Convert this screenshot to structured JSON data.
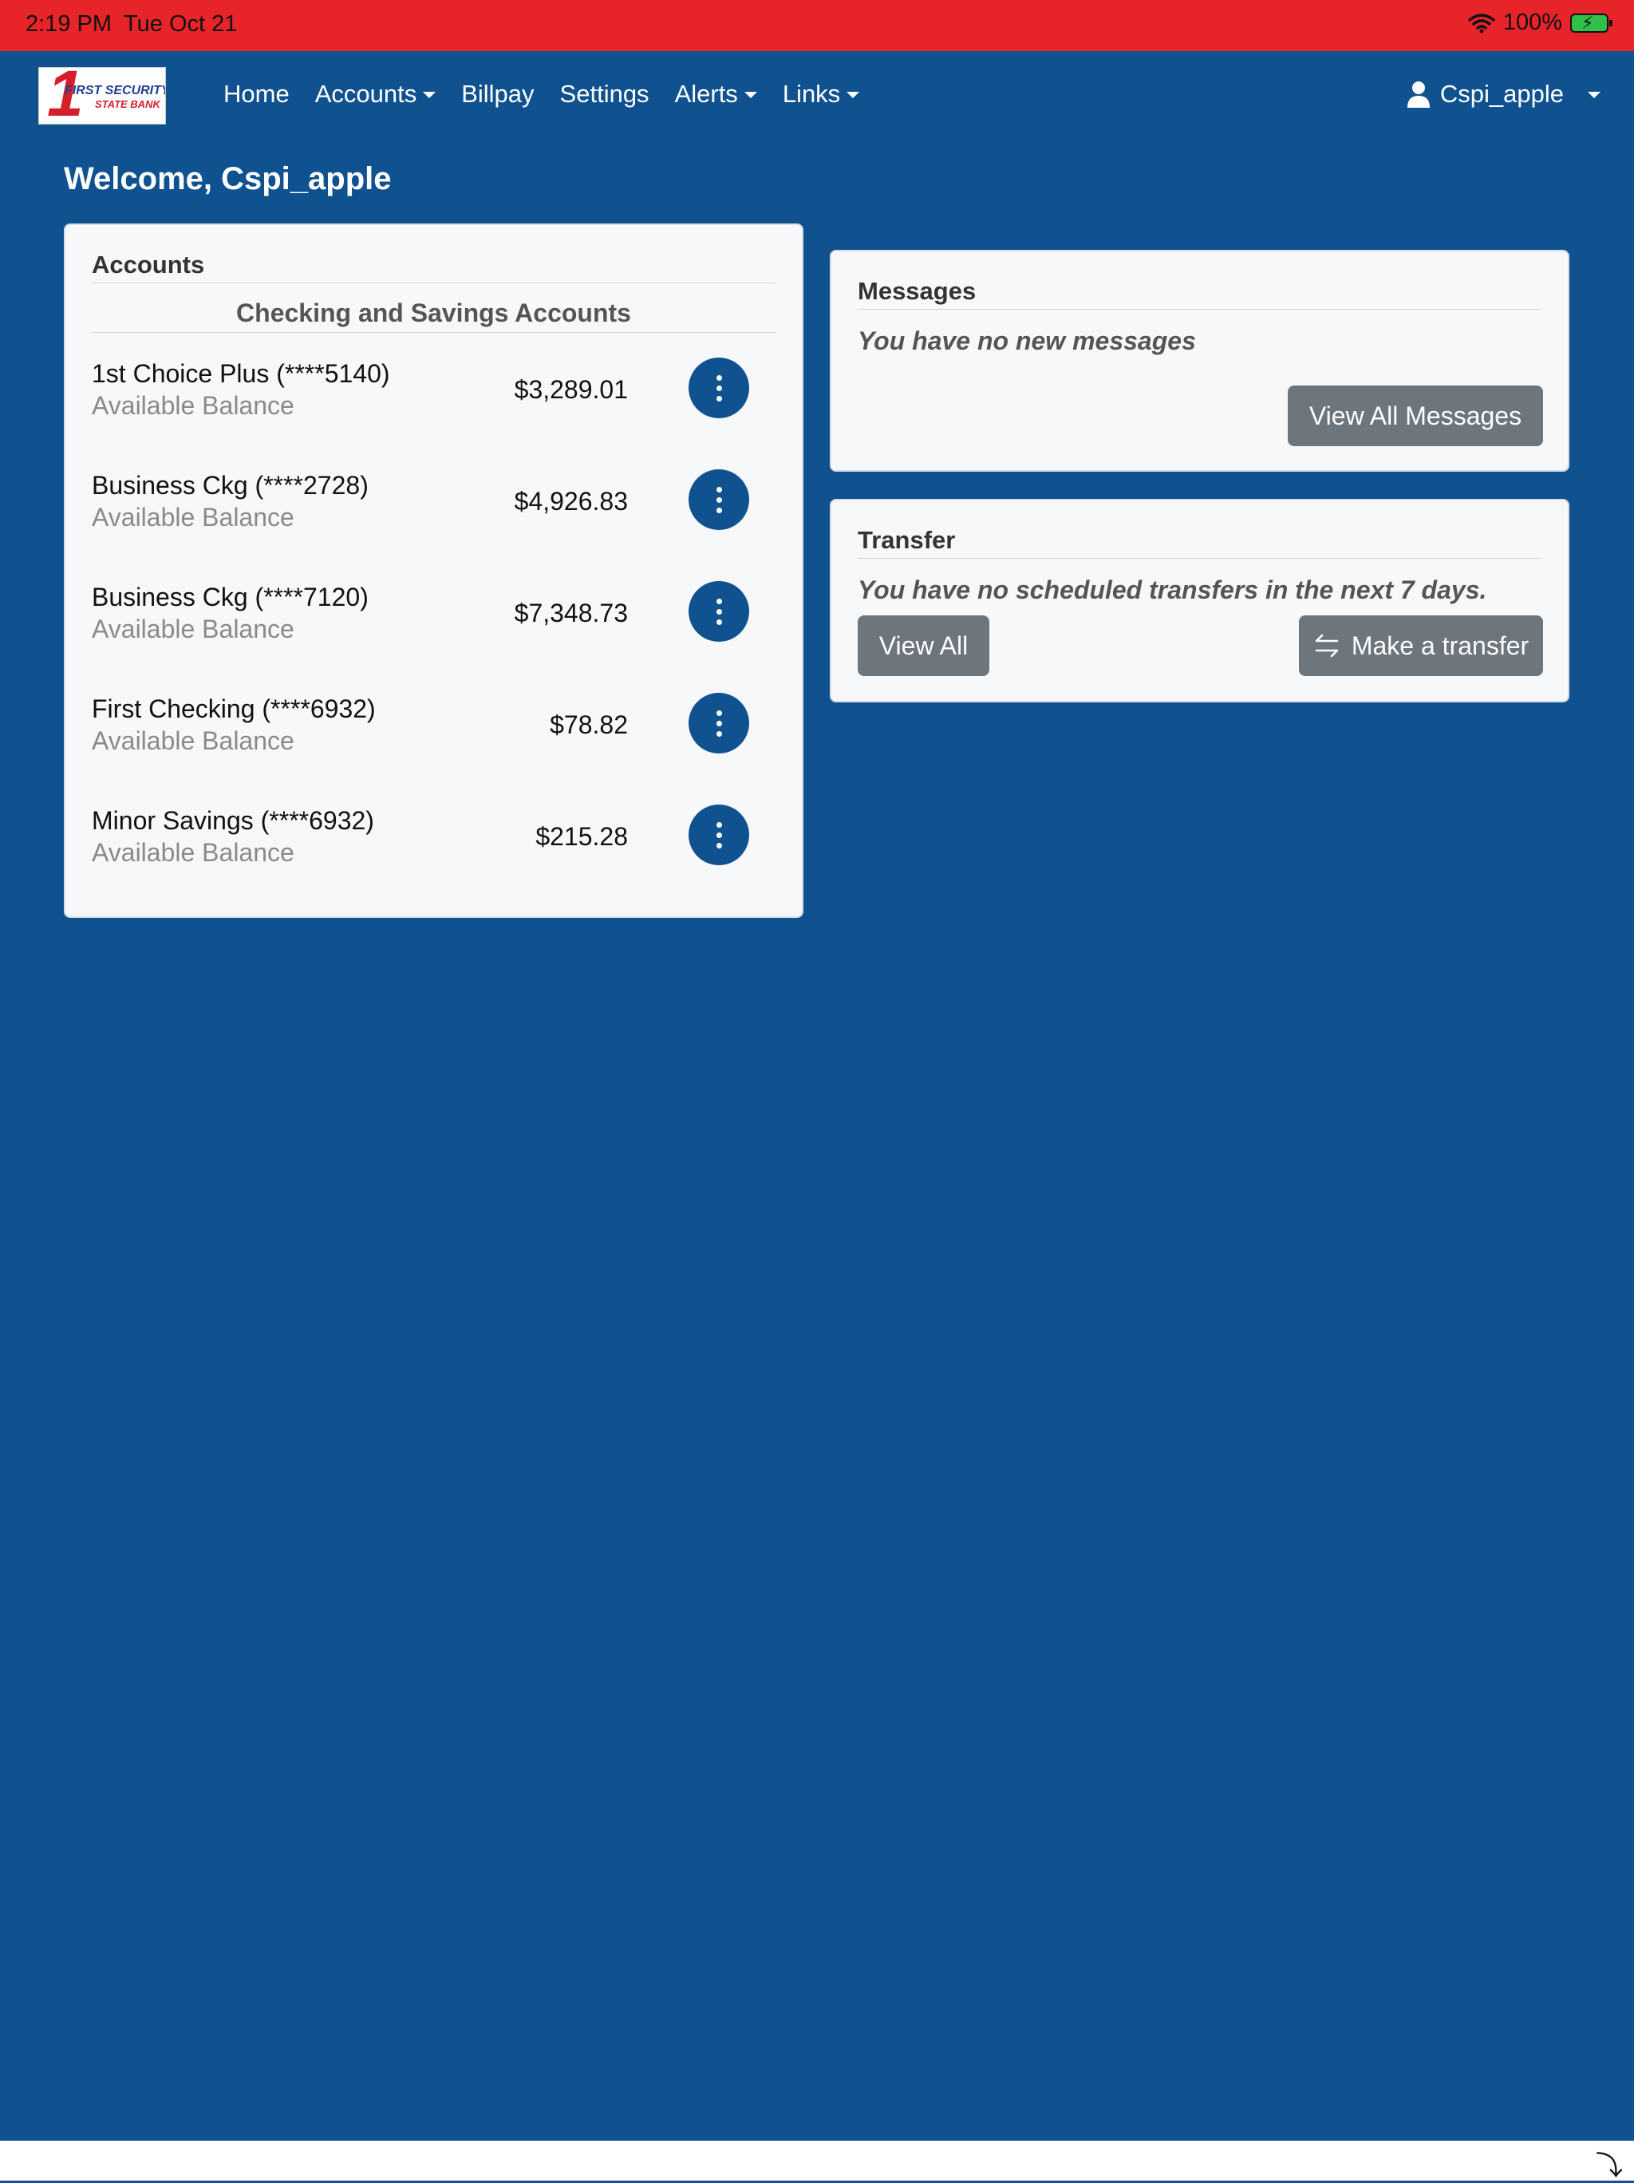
{
  "status": {
    "time": "2:19 PM",
    "date": "Tue Oct 21",
    "battery": "100%"
  },
  "logo": {
    "mark": "1",
    "line1": "FIRST SECURITY",
    "line2": "STATE BANK"
  },
  "nav": {
    "items": [
      {
        "label": "Home",
        "dropdown": false
      },
      {
        "label": "Accounts",
        "dropdown": true
      },
      {
        "label": "Billpay",
        "dropdown": false
      },
      {
        "label": "Settings",
        "dropdown": false
      },
      {
        "label": "Alerts",
        "dropdown": true
      },
      {
        "label": "Links",
        "dropdown": true
      }
    ],
    "user": "Cspi_apple"
  },
  "welcome": "Welcome, Cspi_apple",
  "accounts": {
    "title": "Accounts",
    "subtitle": "Checking and Savings Accounts",
    "rows": [
      {
        "name": "1st Choice Plus (****5140)",
        "label": "Available Balance",
        "balance": "$3,289.01"
      },
      {
        "name": "Business Ckg (****2728)",
        "label": "Available Balance",
        "balance": "$4,926.83"
      },
      {
        "name": "Business Ckg (****7120)",
        "label": "Available Balance",
        "balance": "$7,348.73"
      },
      {
        "name": "First Checking (****6932)",
        "label": "Available Balance",
        "balance": "$78.82"
      },
      {
        "name": "Minor Savings (****6932)",
        "label": "Available Balance",
        "balance": "$215.28"
      }
    ]
  },
  "messages": {
    "title": "Messages",
    "note": "You have no new messages",
    "button": "View All Messages"
  },
  "transfer": {
    "title": "Transfer",
    "note": "You have no scheduled transfers in the next 7 days.",
    "view_all": "View All",
    "make": "Make a transfer"
  },
  "colors": {
    "brand": "#10528f",
    "status_bar": "#e8242b",
    "button": "#6d757d"
  }
}
